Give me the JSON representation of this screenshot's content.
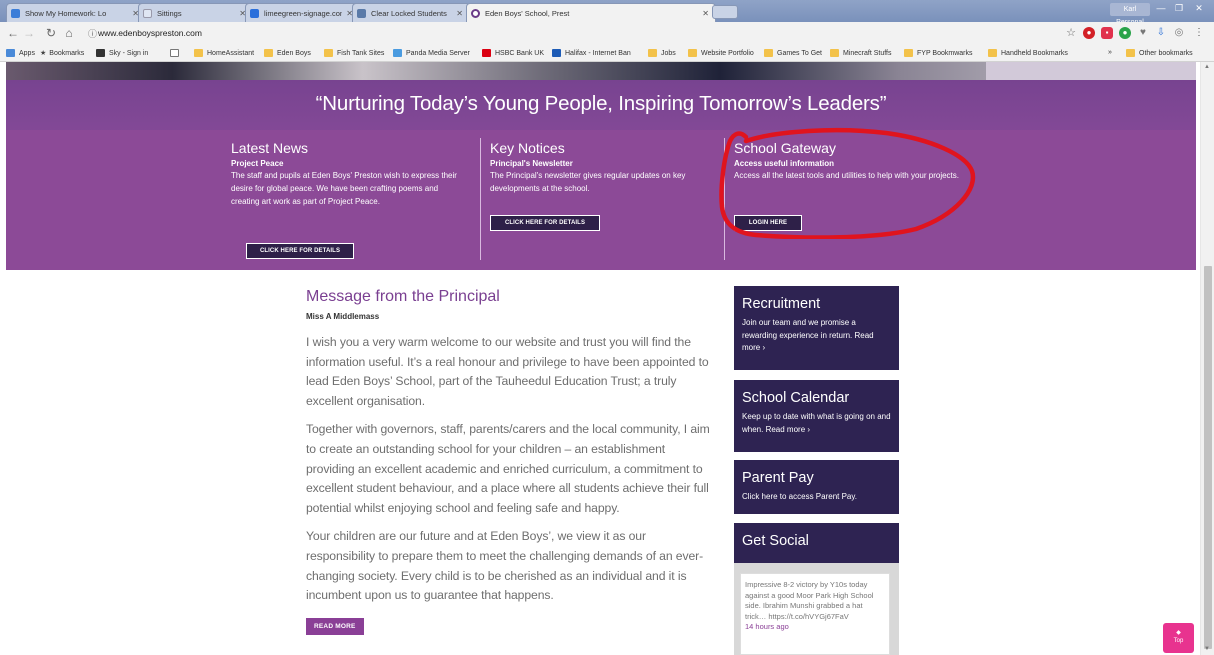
{
  "browser": {
    "tabs": [
      {
        "title": "Show My Homework: Lo",
        "color": "#3b7dd8"
      },
      {
        "title": "Sittings",
        "color": "#dfe6f3"
      },
      {
        "title": "limeegreen-signage.com",
        "color": "#2a6fdb"
      },
      {
        "title": "Clear Locked Students",
        "color": "#5a7aa8"
      },
      {
        "title": "Eden Boys' School, Prest",
        "color": "#6a3b88"
      }
    ],
    "user": "Karl Personal",
    "url": "www.edenboyspreston.com",
    "bookmarks": [
      "Apps",
      "Bookmarks",
      "Sky - Sign in",
      "",
      "HomeAssistant",
      "Eden Boys",
      "Fish Tank Sites",
      "Panda Media Server",
      "HSBC Bank UK",
      "Halifax - Internet Ban",
      "Jobs",
      "Website Portfolio",
      "Games To Get",
      "Minecraft Stuffs",
      "FYP Bookmwarks",
      "Handheld Bookmarks",
      "»",
      "Other bookmarks"
    ]
  },
  "hero": {
    "tagline": "“Nurturing Today’s Young People, Inspiring Tomorrow’s Leaders”",
    "news": {
      "title": "Latest News",
      "subtitle": "Project Peace",
      "body": "The staff and pupils at Eden Boys' Preston wish to express their desire for global peace. We have been crafting poems and creating art work as part of Project Peace.",
      "button": "CLICK HERE FOR DETAILS"
    },
    "notices": {
      "title": "Key Notices",
      "subtitle": "Principal's Newsletter",
      "body": "The Principal's newsletter gives regular updates on key developments at the school.",
      "button": "CLICK HERE FOR DETAILS"
    },
    "gateway": {
      "title": "School Gateway",
      "subtitle": "Access useful information",
      "body": "Access all the latest tools and utilities to help with your projects.",
      "button": "LOGIN HERE"
    }
  },
  "principal": {
    "title": "Message from the Principal",
    "name": "Miss A Middlemass",
    "paragraphs": [
      "I wish you a very warm welcome to our website and trust you will find the information useful. It’s a real honour and privilege to have been appointed to lead Eden Boys’ School, part of the Tauheedul Education Trust; a truly excellent organisation.",
      "Together with governors, staff, parents/carers and the local community, I aim to create an outstanding school for your children – an establishment providing an excellent academic and enriched curriculum, a commitment to excellent student behaviour, and a place where all students achieve their full potential whilst enjoying school and feeling safe and happy.",
      "Your children are our future and at Eden Boys’, we view it as our responsibility to prepare them to meet the challenging demands of an ever-changing society. Every child is to be cherished as an individual and it is incumbent upon us to guarantee that happens."
    ],
    "button": "READ MORE"
  },
  "sidebar": {
    "recruitment": {
      "title": "Recruitment",
      "body": "Join our team and we promise a rewarding experience in return. Read more ›"
    },
    "calendar": {
      "title": "School Calendar",
      "body": "Keep up to date with what is going on and when. Read more ›"
    },
    "parentpay": {
      "title": "Parent Pay",
      "body": "Click here to access Parent Pay."
    },
    "social": {
      "title": "Get Social",
      "tweet": "Impressive 8-2 victory by Y10s today against a good Moor Park High School side. Ibrahim Munshi grabbed a hat trick… https://t.co/hVYGj67FaV",
      "time": "14 hours ago"
    }
  },
  "top_button": "Top",
  "annotation_color": "#e0141e"
}
